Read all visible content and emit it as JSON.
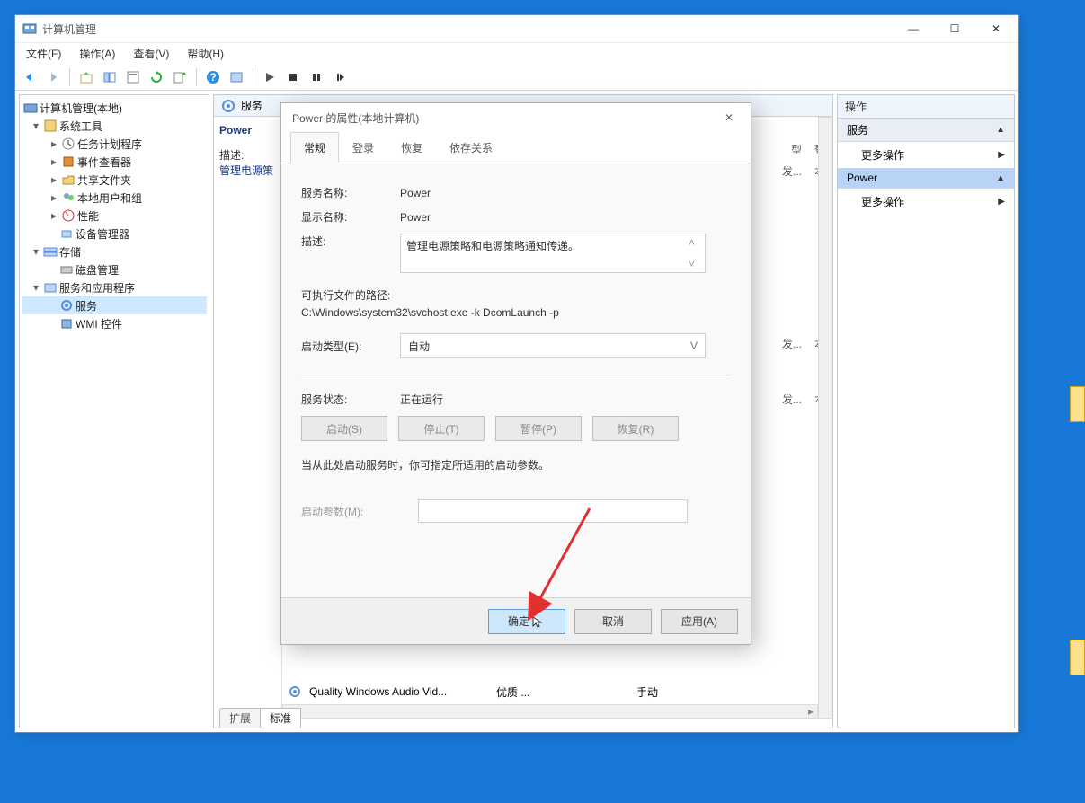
{
  "window": {
    "title": "计算机管理",
    "menus": {
      "file": "文件(F)",
      "action": "操作(A)",
      "view": "查看(V)",
      "help": "帮助(H)"
    },
    "win_buttons": {
      "min": "—",
      "max": "☐",
      "close": "✕"
    }
  },
  "tree": {
    "root": "计算机管理(本地)",
    "sys_tools": "系统工具",
    "task_sched": "任务计划程序",
    "event_viewer": "事件查看器",
    "shared": "共享文件夹",
    "local_users": "本地用户和组",
    "perf": "性能",
    "devmgr": "设备管理器",
    "storage": "存储",
    "diskmgr": "磁盘管理",
    "svc_apps": "服务和应用程序",
    "services": "服务",
    "wmi": "WMI 控件"
  },
  "center": {
    "header": "服务",
    "selected_name": "Power",
    "desc_label": "描述:",
    "desc_text": "管理电源策",
    "bottom_row_name": "Quality Windows Audio Vid...",
    "bottom_row_desc": "优质 ...",
    "bottom_row_start": "手动",
    "col_type_hint": "型",
    "col_status_hint": "登",
    "fa": "发...",
    "ben1": "本",
    "ben2": "本",
    "tabs": {
      "ext": "扩展",
      "std": "标准"
    }
  },
  "actions": {
    "header": "操作",
    "svc_section": "服务",
    "more": "更多操作",
    "power_section": "Power"
  },
  "dialog": {
    "title": "Power 的属性(本地计算机)",
    "tabs": {
      "general": "常规",
      "logon": "登录",
      "recovery": "恢复",
      "deps": "依存关系"
    },
    "labels": {
      "svc_name": "服务名称:",
      "disp_name": "显示名称:",
      "desc": "描述:",
      "exe_path": "可执行文件的路径:",
      "start_type": "启动类型(E):",
      "svc_status": "服务状态:",
      "start_hint": "当从此处启动服务时，你可指定所适用的启动参数。",
      "start_params": "启动参数(M):"
    },
    "values": {
      "svc_name": "Power",
      "disp_name": "Power",
      "desc": "管理电源策略和电源策略通知传递。",
      "exe_path": "C:\\Windows\\system32\\svchost.exe -k DcomLaunch -p",
      "start_type": "自动",
      "svc_status": "正在运行"
    },
    "ctrl_buttons": {
      "start": "启动(S)",
      "stop": "停止(T)",
      "pause": "暂停(P)",
      "resume": "恢复(R)"
    },
    "footer": {
      "ok": "确定",
      "cancel": "取消",
      "apply": "应用(A)"
    }
  }
}
